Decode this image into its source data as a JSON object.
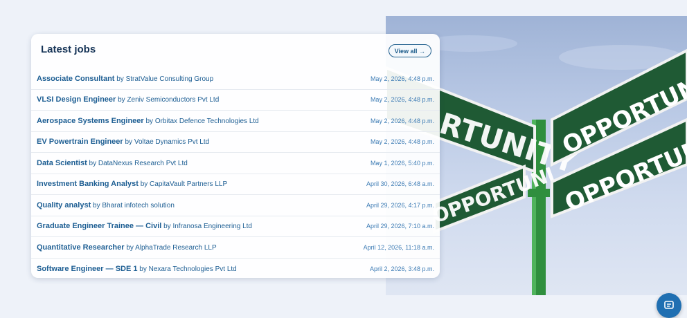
{
  "jobs_card": {
    "title": "Latest jobs",
    "view_all_label": "View all →",
    "by_word": "by",
    "items": [
      {
        "title": "Associate Consultant",
        "company": "StratValue Consulting Group",
        "date": "May 2, 2026, 4:48 p.m."
      },
      {
        "title": "VLSI Design Engineer",
        "company": "Zeniv Semiconductors Pvt Ltd",
        "date": "May 2, 2026, 4:48 p.m."
      },
      {
        "title": "Aerospace Systems Engineer",
        "company": "Orbitax Defence Technologies Ltd",
        "date": "May 2, 2026, 4:48 p.m."
      },
      {
        "title": "EV Powertrain Engineer",
        "company": "Voltae Dynamics Pvt Ltd",
        "date": "May 2, 2026, 4:48 p.m."
      },
      {
        "title": "Data Scientist",
        "company": "DataNexus Research Pvt Ltd",
        "date": "May 1, 2026, 5:40 p.m."
      },
      {
        "title": "Investment Banking Analyst",
        "company": "CapitaVault Partners LLP",
        "date": "April 30, 2026, 6:48 a.m."
      },
      {
        "title": "Quality analyst",
        "company": "Bharat infotech solution",
        "date": "April 29, 2026, 4:17 p.m."
      },
      {
        "title": "Graduate Engineer Trainee — Civil",
        "company": "Infranosa Engineering Ltd",
        "date": "April 29, 2026, 7:10 a.m."
      },
      {
        "title": "Quantitative Researcher",
        "company": "AlphaTrade Research LLP",
        "date": "April 12, 2026, 11:18 a.m."
      },
      {
        "title": "Software Engineer — SDE 1",
        "company": "Nexara Technologies Pvt Ltd",
        "date": "April 2, 2026, 3:48 p.m."
      }
    ]
  },
  "hero_image": {
    "sign_text": "OPPORTUNITY",
    "sign_text_partial_1": "RTUNITY",
    "sign_text_partial_2": "OPPORTUNI"
  },
  "chat_button": {
    "icon": "chat-icon"
  },
  "colors": {
    "background": "#eef2f9",
    "title": "#163457",
    "link": "#1d5e93",
    "date": "#3c7bb4",
    "sign_green": "#1f5a34",
    "accent": "#1f6fb2"
  }
}
